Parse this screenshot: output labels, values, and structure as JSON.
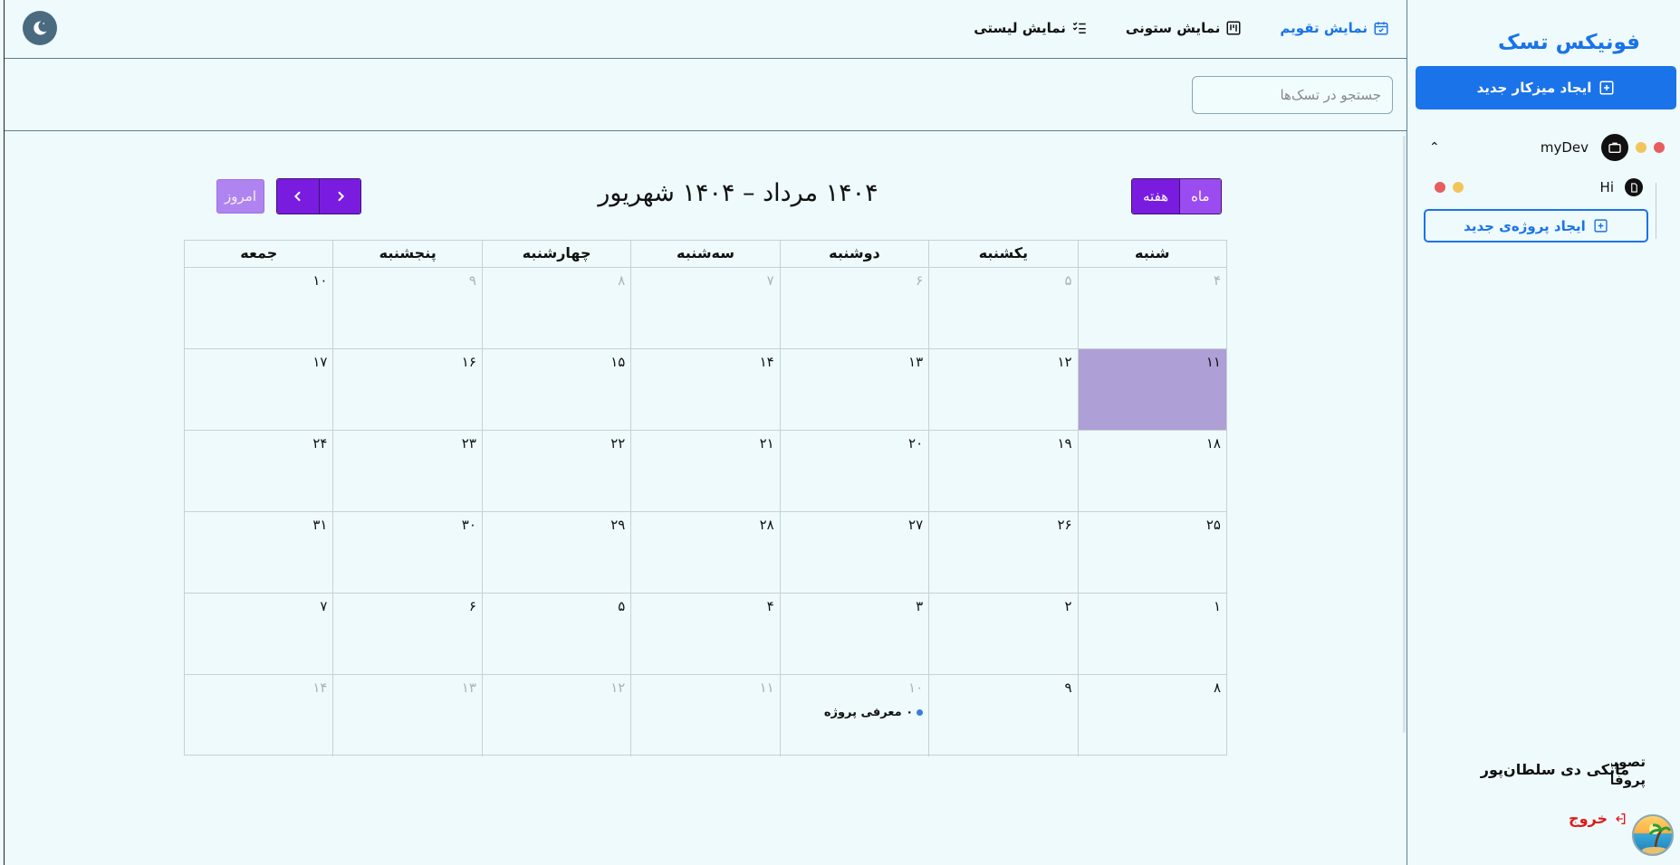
{
  "topbar": {
    "views": [
      {
        "label": "نمایش لیستی",
        "icon": "list-check-icon"
      },
      {
        "label": "نمایش ستونی",
        "icon": "kanban-icon"
      },
      {
        "label": "نمایش تقویم",
        "icon": "calendar-check-icon"
      }
    ],
    "theme_toggle_icon": "moon-icon"
  },
  "search": {
    "placeholder": "جستجو در تسک‌ها"
  },
  "calendar": {
    "title": "۱۴۰۴ مرداد – ۱۴۰۴ شهریور",
    "mode_week": "هفته",
    "mode_month": "ماه",
    "today_label": "امروز",
    "weekdays": [
      "شنبه",
      "یکشنبه",
      "دوشنبه",
      "سه‌شنبه",
      "چهارشنبه",
      "پنجشنبه",
      "جمعه"
    ],
    "weeks": [
      [
        {
          "d": "۴",
          "o": true
        },
        {
          "d": "۵",
          "o": true
        },
        {
          "d": "۶",
          "o": true
        },
        {
          "d": "۷",
          "o": true
        },
        {
          "d": "۸",
          "o": true
        },
        {
          "d": "۹",
          "o": true
        },
        {
          "d": "۱۰",
          "o": false
        }
      ],
      [
        {
          "d": "۱۱",
          "o": false,
          "today": true
        },
        {
          "d": "۱۲",
          "o": false
        },
        {
          "d": "۱۳",
          "o": false
        },
        {
          "d": "۱۴",
          "o": false
        },
        {
          "d": "۱۵",
          "o": false
        },
        {
          "d": "۱۶",
          "o": false
        },
        {
          "d": "۱۷",
          "o": false
        }
      ],
      [
        {
          "d": "۱۸",
          "o": false
        },
        {
          "d": "۱۹",
          "o": false
        },
        {
          "d": "۲۰",
          "o": false
        },
        {
          "d": "۲۱",
          "o": false
        },
        {
          "d": "۲۲",
          "o": false
        },
        {
          "d": "۲۳",
          "o": false
        },
        {
          "d": "۲۴",
          "o": false
        }
      ],
      [
        {
          "d": "۲۵",
          "o": false
        },
        {
          "d": "۲۶",
          "o": false
        },
        {
          "d": "۲۷",
          "o": false
        },
        {
          "d": "۲۸",
          "o": false
        },
        {
          "d": "۲۹",
          "o": false
        },
        {
          "d": "۳۰",
          "o": false
        },
        {
          "d": "۳۱",
          "o": false
        }
      ],
      [
        {
          "d": "۱",
          "o": false
        },
        {
          "d": "۲",
          "o": false
        },
        {
          "d": "۳",
          "o": false
        },
        {
          "d": "۴",
          "o": false
        },
        {
          "d": "۵",
          "o": false
        },
        {
          "d": "۶",
          "o": false
        },
        {
          "d": "۷",
          "o": false
        }
      ],
      [
        {
          "d": "۸",
          "o": false
        },
        {
          "d": "۹",
          "o": false
        },
        {
          "d": "۱۰",
          "o": true,
          "event": "۰ معرفی پروژه"
        },
        {
          "d": "۱۱",
          "o": true
        },
        {
          "d": "۱۲",
          "o": true
        },
        {
          "d": "۱۳",
          "o": true
        },
        {
          "d": "۱۴",
          "o": true
        }
      ]
    ],
    "accent": "#7a1ce0",
    "today_bg": "#ae9fd6"
  },
  "sidebar": {
    "brand": "فونیکس تسک",
    "new_workspace": "ایجاد میزکار جدید",
    "workspace": {
      "name": "myDev",
      "icon": "briefcase-icon"
    },
    "project": {
      "name": "Hi",
      "icon": "document-icon"
    },
    "new_project": "ایجاد پروژه‌ی جدید",
    "user_name": "مانکی دی سلطان‌پور",
    "avatar_alt": "تصویر پروفایل",
    "avatar_alt_line1": "تصویر",
    "avatar_alt_line2": "پروفایل",
    "logout": "خروج",
    "brand_color": "#1a73e8"
  }
}
